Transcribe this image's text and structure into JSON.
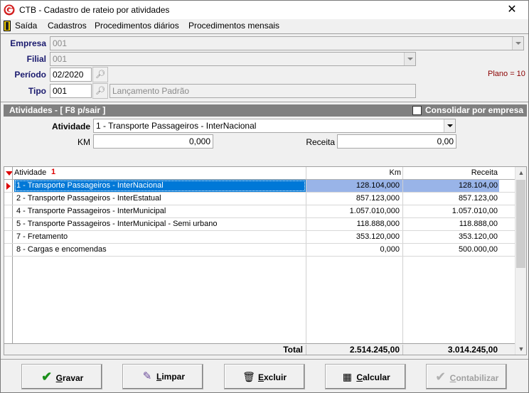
{
  "window": {
    "title": "CTB - Cadastro de rateio por atividades",
    "close_glyph": "✕"
  },
  "menu": {
    "items": [
      "Saída",
      "Cadastros",
      "Procedimentos diários",
      "Procedimentos mensais"
    ]
  },
  "form": {
    "empresa": {
      "label": "Empresa",
      "value": "001"
    },
    "filial": {
      "label": "Filial",
      "value": "001"
    },
    "periodo": {
      "label": "Período",
      "value": "02/2020"
    },
    "tipo": {
      "label": "Tipo",
      "value": "001",
      "descricao": "Lançamento Padrão"
    },
    "plano": "Plano = 10"
  },
  "atividades": {
    "header": "Atividades - [ F8 p/sair ]",
    "consolidar_label": "Consolidar por empresa",
    "atividade_label": "Atividade",
    "atividade_value": "1 - Transporte Passageiros - InterNacional",
    "km_label": "KM",
    "km_value": "0,000",
    "receita_label": "Receita",
    "receita_value": "0,00"
  },
  "grid": {
    "columns": [
      "Atividade",
      "Km",
      "Receita"
    ],
    "sort_marker": "1",
    "rows": [
      {
        "atividade": "1 - Transporte Passageiros - InterNacional",
        "km": "128.104,000",
        "receita": "128.104,00"
      },
      {
        "atividade": "2 - Transporte Passageiros - InterEstatual",
        "km": "857.123,000",
        "receita": "857.123,00"
      },
      {
        "atividade": "4 - Transporte Passageiros - InterMunicipal",
        "km": "1.057.010,000",
        "receita": "1.057.010,00"
      },
      {
        "atividade": "5 - Transporte Passageiros - InterMunicipal - Semi urbano",
        "km": "118.888,000",
        "receita": "118.888,00"
      },
      {
        "atividade": "7 - Fretamento",
        "km": "353.120,000",
        "receita": "353.120,00"
      },
      {
        "atividade": "8 - Cargas e encomendas",
        "km": "0,000",
        "receita": "500.000,00"
      }
    ],
    "total_label": "Total",
    "total_km": "2.514.245,00",
    "total_receita": "3.014.245,00"
  },
  "buttons": {
    "gravar": {
      "mnemonic": "G",
      "rest": "ravar"
    },
    "limpar": {
      "mnemonic": "L",
      "rest": "impar"
    },
    "excluir": {
      "mnemonic": "E",
      "rest": "xcluir"
    },
    "calcular": {
      "mnemonic": "C",
      "rest": "alcular"
    },
    "contabilizar": {
      "mnemonic": "C",
      "rest": "ontabilizar"
    }
  }
}
